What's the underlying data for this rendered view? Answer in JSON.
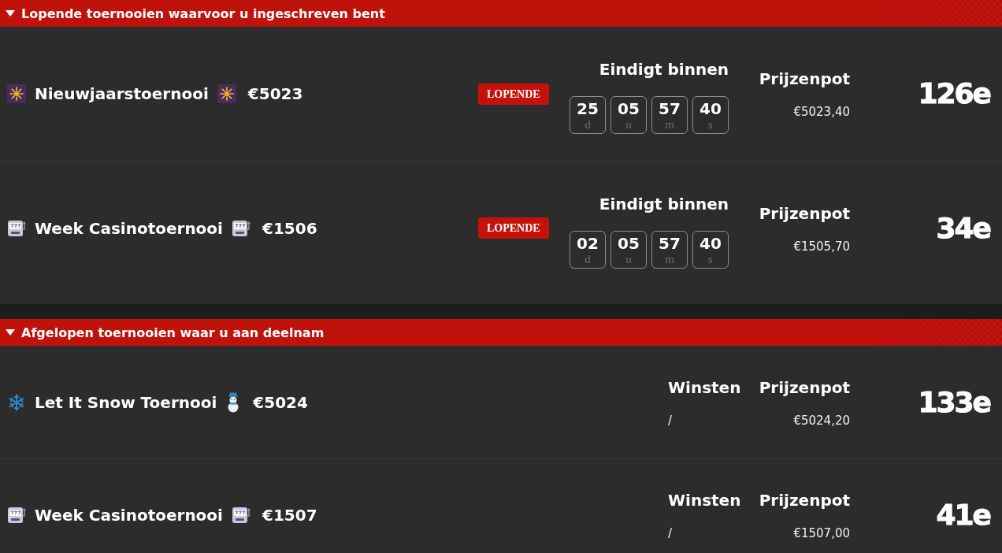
{
  "sections": [
    {
      "title": "Lopende toernooien waarvoor u ingeschreven bent",
      "expanded": true,
      "rows": [
        {
          "icons": [
            {
              "kind": "firework"
            },
            {
              "kind": "firework"
            }
          ],
          "name": "Nieuwjaarstoernooi",
          "amount": "€5023",
          "status": "LOPENDE",
          "countdown": {
            "label": "Eindigt binnen",
            "units": [
              {
                "value": "25",
                "unit": "d"
              },
              {
                "value": "05",
                "unit": "u"
              },
              {
                "value": "57",
                "unit": "m"
              },
              {
                "value": "40",
                "unit": "s"
              }
            ]
          },
          "prize": {
            "label": "Prijzenpot",
            "value": "€5023,40"
          },
          "rank": "126e"
        },
        {
          "icons": [
            {
              "kind": "slots"
            },
            {
              "kind": "slots"
            }
          ],
          "name": "Week Casinotoernooi",
          "amount": "€1506",
          "status": "LOPENDE",
          "countdown": {
            "label": "Eindigt binnen",
            "units": [
              {
                "value": "02",
                "unit": "d"
              },
              {
                "value": "05",
                "unit": "u"
              },
              {
                "value": "57",
                "unit": "m"
              },
              {
                "value": "40",
                "unit": "s"
              }
            ]
          },
          "prize": {
            "label": "Prijzenpot",
            "value": "€1505,70"
          },
          "rank": "34e"
        }
      ]
    },
    {
      "title": "Afgelopen toernooien waar u aan deelnam",
      "expanded": true,
      "rows": [
        {
          "icons": [
            {
              "kind": "snowflake"
            },
            {
              "kind": "snowman"
            }
          ],
          "name": "Let It Snow Toernooi",
          "amount": "€5024",
          "winnings": {
            "label": "Winsten",
            "value": "/"
          },
          "prize": {
            "label": "Prijzenpot",
            "value": "€5024,20"
          },
          "rank": "133e"
        },
        {
          "icons": [
            {
              "kind": "slots"
            },
            {
              "kind": "slots"
            }
          ],
          "name": "Week Casinotoernooi",
          "amount": "€1507",
          "winnings": {
            "label": "Winsten",
            "value": "/"
          },
          "prize": {
            "label": "Prijzenpot",
            "value": "€1507,00"
          },
          "rank": "41e"
        }
      ]
    }
  ]
}
